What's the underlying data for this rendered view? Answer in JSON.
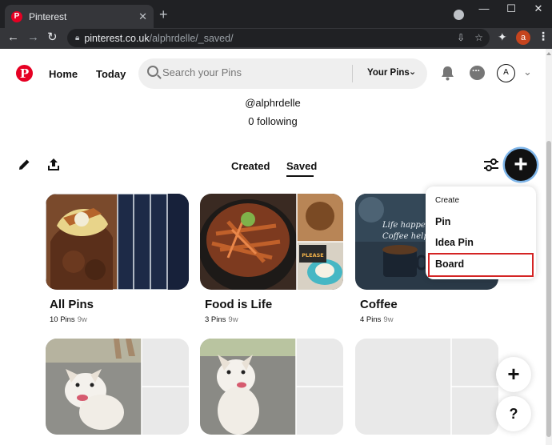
{
  "browser": {
    "tab_title": "Pinterest",
    "tab_close": "✕",
    "new_tab": "+",
    "url_host": "pinterest.co.uk",
    "url_path": "/alphrdelle/_saved/",
    "profile_initial": "a",
    "window_controls": [
      "—",
      "☐",
      "✕"
    ]
  },
  "header": {
    "logo_letter": "P",
    "nav": [
      "Home",
      "Today"
    ],
    "search_placeholder": "Search your Pins",
    "search_scope": "Your Pins",
    "avatar_initial": "A"
  },
  "profile": {
    "username": "@alphrdelle",
    "following": "0 following"
  },
  "tabs": {
    "created": "Created",
    "saved": "Saved",
    "active": "Saved"
  },
  "create_menu": {
    "heading": "Create",
    "items": [
      "Pin",
      "Idea Pin",
      "Board"
    ],
    "highlighted": "Board"
  },
  "boards": [
    {
      "name": "All Pins",
      "pins": "10 Pins",
      "age": "9w"
    },
    {
      "name": "Food is Life",
      "pins": "3 Pins",
      "age": "9w"
    },
    {
      "name": "Coffee",
      "pins": "4 Pins",
      "age": "9w"
    }
  ],
  "coffee_image_text": [
    "Life happens",
    "Coffee helps"
  ],
  "food_image_text": "PLEASE",
  "fabs": {
    "add": "+",
    "help": "?"
  },
  "colors": {
    "brand": "#e60023",
    "highlight_outline": "#d42424",
    "focus_ring": "#7fb6ea"
  }
}
